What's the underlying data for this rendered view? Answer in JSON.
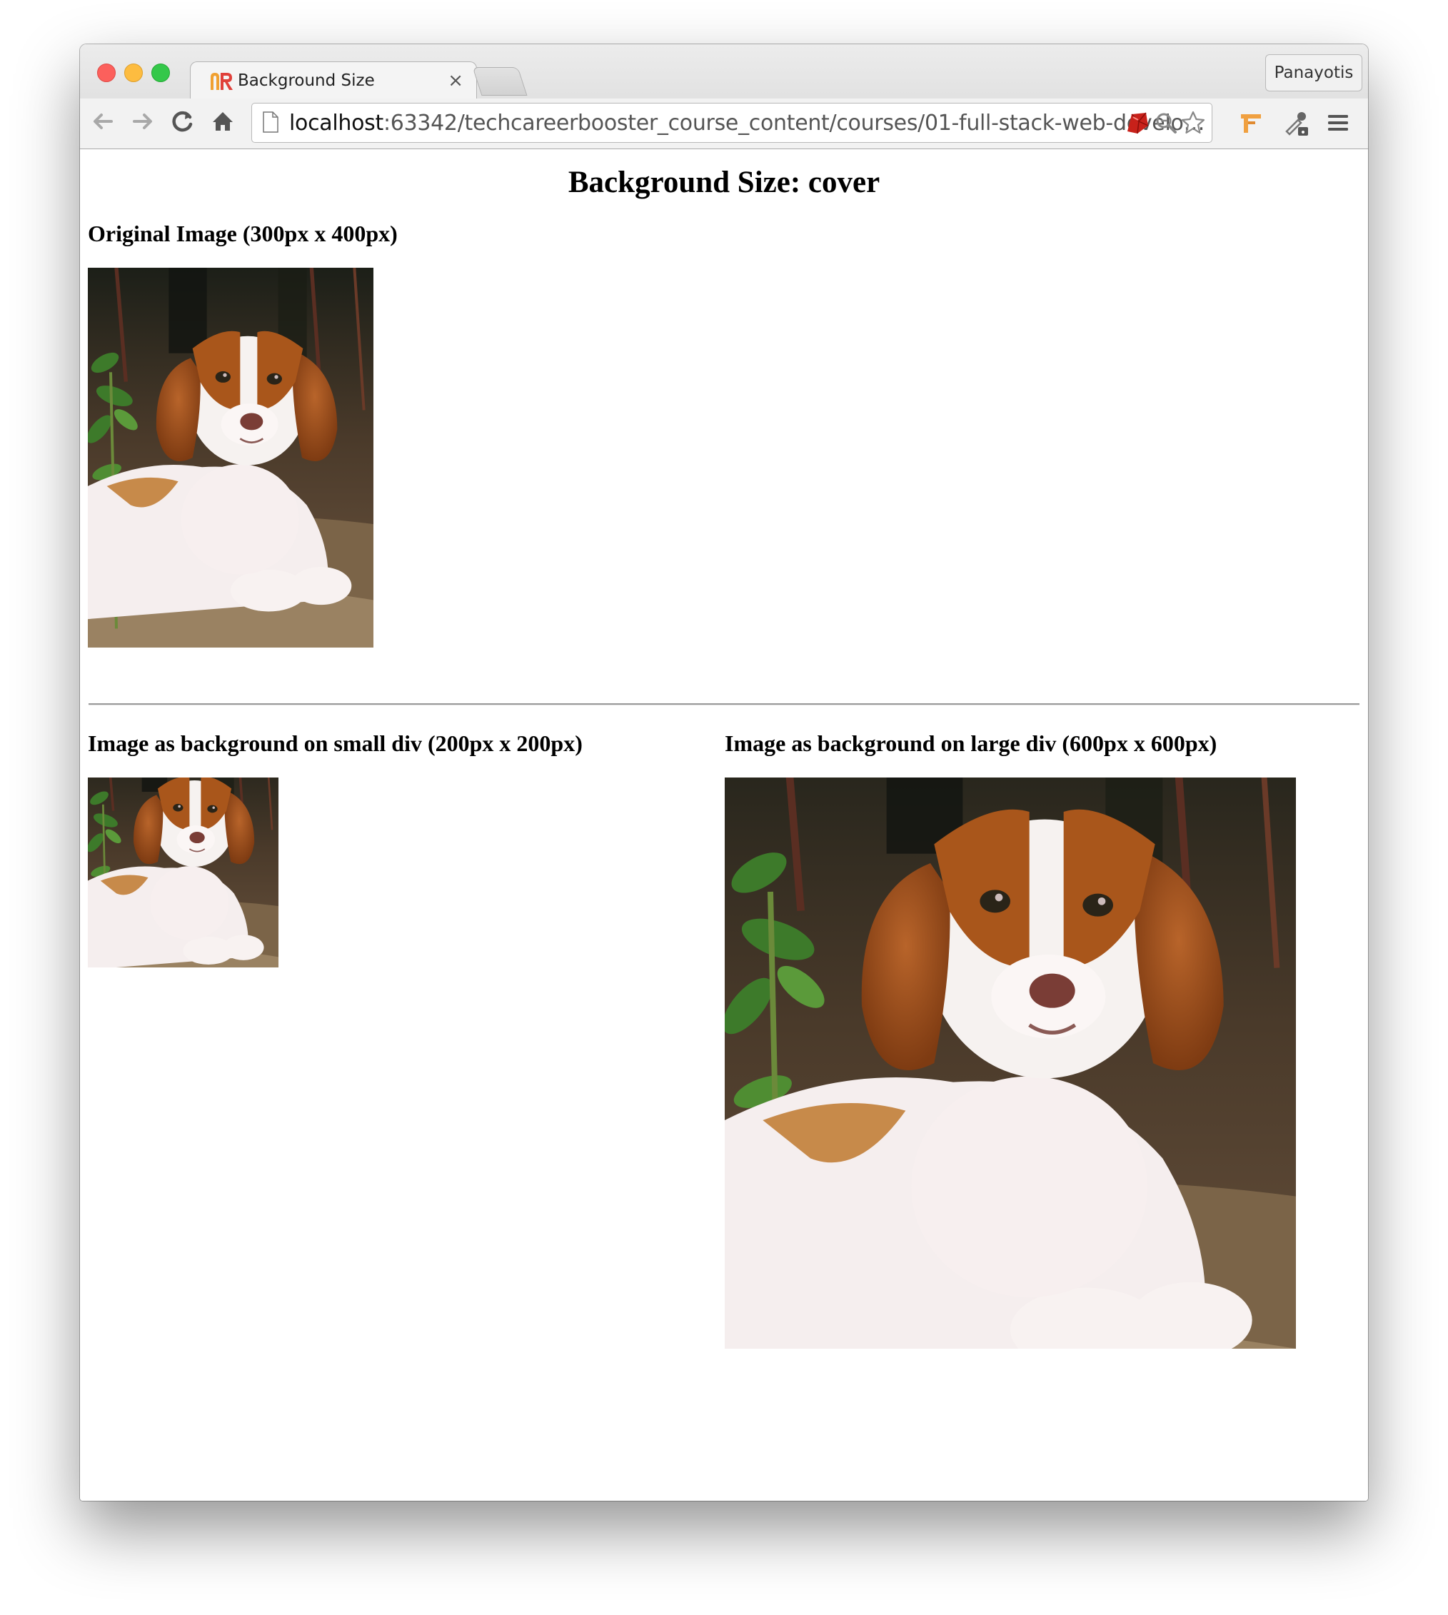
{
  "browser": {
    "tab_title": "Background Size",
    "tab_close": "×",
    "profile_name": "Panayotis",
    "url_host": "localhost",
    "url_rest": ":63342/techcareerbooster_course_content/courses/01-full-stack-web-develo…"
  },
  "page": {
    "heading": "Background Size: cover",
    "original_label": "Original Image (300px x 400px)",
    "small_label": "Image as background on small div (200px x 200px)",
    "large_label": "Image as background on large div (600px x 600px)"
  },
  "colors": {
    "close": "#fc605c",
    "minimize": "#fdbc40",
    "maximize": "#34c84a",
    "dog_brown": "#a9561b",
    "dog_white": "#f6f1ef"
  }
}
